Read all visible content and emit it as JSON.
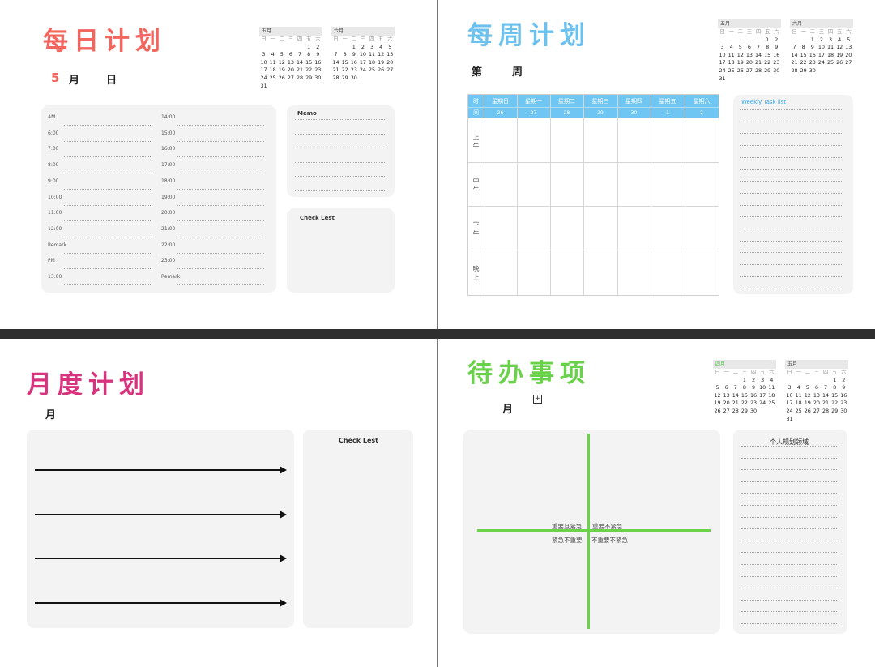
{
  "daily": {
    "title": "每日计划",
    "date_month_num": "5",
    "date_month": "月",
    "date_day": "日",
    "left_times": [
      "AM",
      "6:00",
      "7:00",
      "8:00",
      "9:00",
      "10:00",
      "11:00",
      "12:00",
      "Remark",
      "PM",
      "13:00"
    ],
    "right_times": [
      "14:00",
      "15:00",
      "16:00",
      "17:00",
      "18:00",
      "19:00",
      "20:00",
      "21:00",
      "22:00",
      "23:00",
      "Remark"
    ],
    "memo_title": "Memo",
    "checklist_title": "Check Lest",
    "cal_may": {
      "name": "五月",
      "weekdays": [
        "日",
        "一",
        "二",
        "三",
        "四",
        "五",
        "六"
      ],
      "rows": [
        [
          "",
          "",
          "",
          "",
          "",
          "1",
          "2"
        ],
        [
          "3",
          "4",
          "5",
          "6",
          "7",
          "8",
          "9"
        ],
        [
          "10",
          "11",
          "12",
          "13",
          "14",
          "15",
          "16"
        ],
        [
          "17",
          "18",
          "19",
          "20",
          "21",
          "22",
          "23"
        ],
        [
          "24",
          "25",
          "26",
          "27",
          "28",
          "29",
          "30"
        ],
        [
          "31",
          "",
          "",
          "",
          "",
          "",
          ""
        ]
      ]
    },
    "cal_june": {
      "name": "六月",
      "weekdays": [
        "日",
        "一",
        "二",
        "三",
        "四",
        "五",
        "六"
      ],
      "rows": [
        [
          "",
          "",
          "1",
          "2",
          "3",
          "4",
          "5",
          "6"
        ],
        [
          "7",
          "8",
          "9",
          "10",
          "11",
          "12",
          "13"
        ],
        [
          "14",
          "15",
          "16",
          "17",
          "18",
          "19",
          "20"
        ],
        [
          "21",
          "22",
          "23",
          "24",
          "25",
          "26",
          "27"
        ],
        [
          "28",
          "29",
          "30",
          "",
          "",
          "",
          ""
        ]
      ]
    }
  },
  "weekly": {
    "title": "每周计划",
    "week_label_a": "第",
    "week_label_b": "周",
    "corner": [
      "时",
      "间"
    ],
    "days": [
      {
        "name": "星期日",
        "date": "26"
      },
      {
        "name": "星期一",
        "date": "27"
      },
      {
        "name": "星期二",
        "date": "28"
      },
      {
        "name": "星期三",
        "date": "29"
      },
      {
        "name": "星期四",
        "date": "30"
      },
      {
        "name": "星期五",
        "date": "1"
      },
      {
        "name": "星期六",
        "date": "2"
      }
    ],
    "periods": [
      [
        "上",
        "午"
      ],
      [
        "中",
        "午"
      ],
      [
        "下",
        "午"
      ],
      [
        "晚",
        "上"
      ]
    ],
    "task_title": "Weekly Task list",
    "cal_may": {
      "name": "五月",
      "weekdays": [
        "日",
        "一",
        "二",
        "三",
        "四",
        "五",
        "六"
      ],
      "rows": [
        [
          "",
          "",
          "",
          "",
          "",
          "1",
          "2"
        ],
        [
          "3",
          "4",
          "5",
          "6",
          "7",
          "8",
          "9"
        ],
        [
          "10",
          "11",
          "12",
          "13",
          "14",
          "15",
          "16"
        ],
        [
          "17",
          "18",
          "19",
          "20",
          "21",
          "22",
          "23"
        ],
        [
          "24",
          "25",
          "26",
          "27",
          "28",
          "29",
          "30"
        ],
        [
          "31",
          "",
          "",
          "",
          "",
          "",
          ""
        ]
      ]
    },
    "cal_june": {
      "name": "六月",
      "weekdays": [
        "日",
        "一",
        "二",
        "三",
        "四",
        "五",
        "六"
      ],
      "rows": [
        [
          "",
          "",
          "1",
          "2",
          "3",
          "4",
          "5",
          "6"
        ],
        [
          "7",
          "8",
          "9",
          "10",
          "11",
          "12",
          "13"
        ],
        [
          "14",
          "15",
          "16",
          "17",
          "18",
          "19",
          "20"
        ],
        [
          "21",
          "22",
          "23",
          "24",
          "25",
          "26",
          "27"
        ],
        [
          "28",
          "29",
          "30",
          "",
          "",
          "",
          ""
        ]
      ]
    }
  },
  "monthly": {
    "title": "月度计划",
    "month_label": "月",
    "checklist_title": "Check Lest"
  },
  "todo": {
    "title": "待办事项",
    "month_label": "月",
    "add_icon": "plus-square-icon",
    "q_top_left": "重要且紧急",
    "q_top_right": "重要不紧急",
    "q_bottom_left": "紧急不重要",
    "q_bottom_right": "不重要不紧急",
    "side_title": "个人规划领域",
    "cal_april": {
      "name": "四月",
      "weekdays": [
        "日",
        "一",
        "二",
        "三",
        "四",
        "五",
        "六"
      ],
      "rows": [
        [
          "",
          "",
          "",
          "1",
          "2",
          "3",
          "4"
        ],
        [
          "5",
          "6",
          "7",
          "8",
          "9",
          "10",
          "11"
        ],
        [
          "12",
          "13",
          "14",
          "15",
          "16",
          "17",
          "18"
        ],
        [
          "19",
          "20",
          "21",
          "22",
          "23",
          "24",
          "25"
        ],
        [
          "26",
          "27",
          "28",
          "29",
          "30",
          "",
          ""
        ]
      ]
    },
    "cal_may": {
      "name": "五月",
      "weekdays": [
        "日",
        "一",
        "二",
        "三",
        "四",
        "五",
        "六"
      ],
      "rows": [
        [
          "",
          "",
          "",
          "",
          "",
          "1",
          "2"
        ],
        [
          "3",
          "4",
          "5",
          "6",
          "7",
          "8",
          "9"
        ],
        [
          "10",
          "11",
          "12",
          "13",
          "14",
          "15",
          "16"
        ],
        [
          "17",
          "18",
          "19",
          "20",
          "21",
          "22",
          "23"
        ],
        [
          "24",
          "25",
          "26",
          "27",
          "28",
          "29",
          "30"
        ],
        [
          "31",
          "",
          "",
          "",
          "",
          "",
          ""
        ]
      ]
    }
  },
  "colors": {
    "daily_title": "#f2665f",
    "weekly_title": "#6cc1ee",
    "monthly_title": "#d8347e",
    "todo_title": "#6ad24a",
    "todo_axis": "#6bd348",
    "weekly_header": "#6fc6f2",
    "april_label": "#52c24a"
  }
}
